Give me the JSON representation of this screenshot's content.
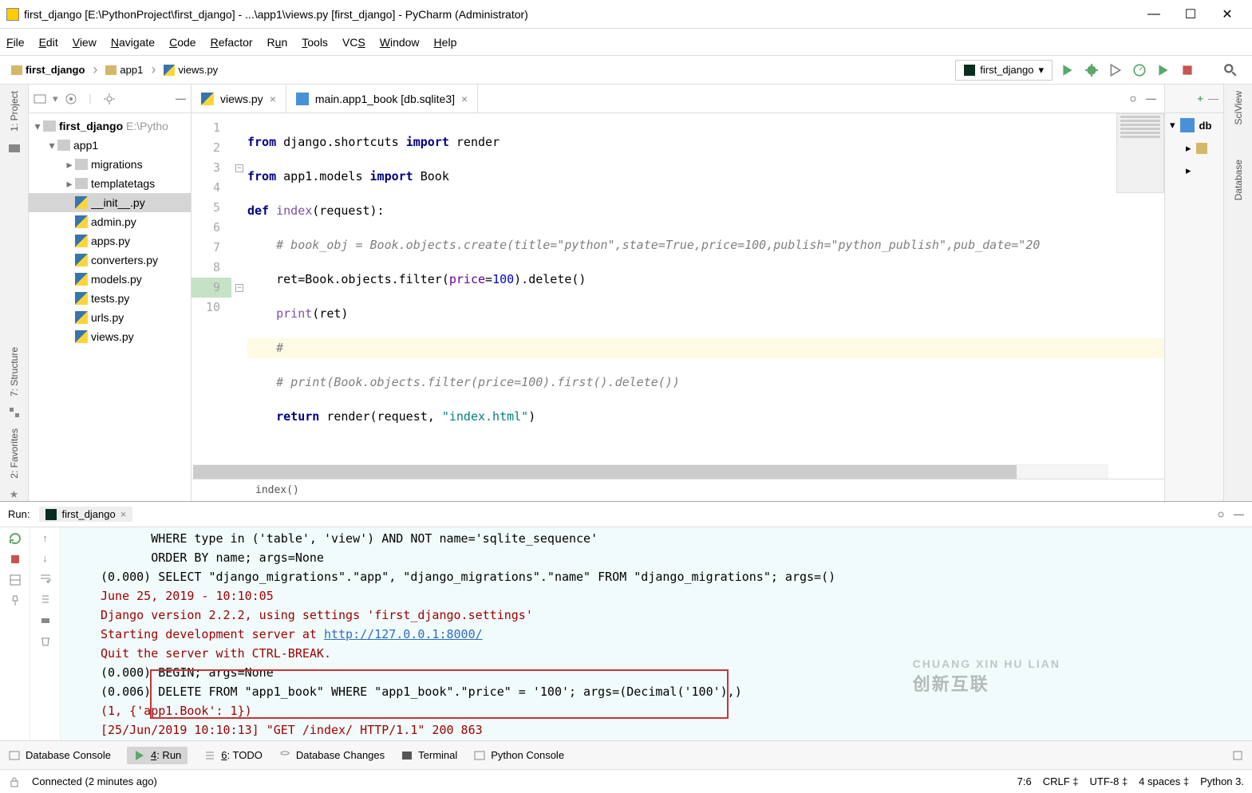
{
  "titlebar": {
    "text": "first_django [E:\\PythonProject\\first_django] - ...\\app1\\views.py [first_django] - PyCharm (Administrator)"
  },
  "menu": {
    "file": "File",
    "edit": "Edit",
    "view": "View",
    "navigate": "Navigate",
    "code": "Code",
    "refactor": "Refactor",
    "run": "Run",
    "tools": "Tools",
    "vcs": "VCS",
    "window": "Window",
    "help": "Help"
  },
  "breadcrumbs": {
    "0": "first_django",
    "1": "app1",
    "2": "views.py"
  },
  "run_config": "first_django",
  "project_toolbar": {},
  "tree": {
    "root": "first_django",
    "root_path": "E:\\Pytho",
    "app1": "app1",
    "migrations": "migrations",
    "templatetags": "templatetags",
    "files": {
      "init": "__init__.py",
      "admin": "admin.py",
      "apps": "apps.py",
      "converters": "converters.py",
      "models": "models.py",
      "tests": "tests.py",
      "urls": "urls.py",
      "views": "views.py"
    }
  },
  "tabs": {
    "views": "views.py",
    "db": "main.app1_book [db.sqlite3]"
  },
  "gutter": [
    "1",
    "2",
    "3",
    "4",
    "5",
    "6",
    "7",
    "8",
    "9",
    "10"
  ],
  "code_bc": "index()",
  "console": {
    "l1": "       WHERE type in ('table', 'view') AND NOT name='sqlite_sequence'",
    "l2": "       ORDER BY name; args=None",
    "l3": "(0.000) SELECT \"django_migrations\".\"app\", \"django_migrations\".\"name\" FROM \"django_migrations\"; args=()",
    "l4": "June 25, 2019 - 10:10:05",
    "l5": "Django version 2.2.2, using settings 'first_django.settings'",
    "l6a": "Starting development server at ",
    "l6b": "http://127.0.0.1:8000/",
    "l7": "Quit the server with CTRL-BREAK.",
    "l8": "(0.000) BEGIN; args=None",
    "l9": "(0.006) DELETE FROM \"app1_book\" WHERE \"app1_book\".\"price\" = '100'; args=(Decimal('100'),)",
    "l10": "(1, {'app1.Book': 1})",
    "l11": "[25/Jun/2019 10:10:13] \"GET /index/ HTTP/1.1\" 200 863"
  },
  "run_label": "Run:",
  "run_tab": "first_django",
  "bottombar": {
    "db": "Database Console",
    "run": "4: Run",
    "todo": "6: TODO",
    "dbch": "Database Changes",
    "term": "Terminal",
    "pycon": "Python Console"
  },
  "statusbar": {
    "conn": "Connected (2 minutes ago)",
    "pos": "7:6",
    "crlf": "CRLF",
    "enc": "UTF-8",
    "indent": "4 spaces",
    "py": "Python 3."
  },
  "rail": {
    "project": "1: Project",
    "structure": "7: Structure",
    "favorites": "2: Favorites",
    "sciview": "SciView",
    "database": "Database"
  },
  "rpanel": {
    "db": "db"
  },
  "watermark": "创新互联"
}
